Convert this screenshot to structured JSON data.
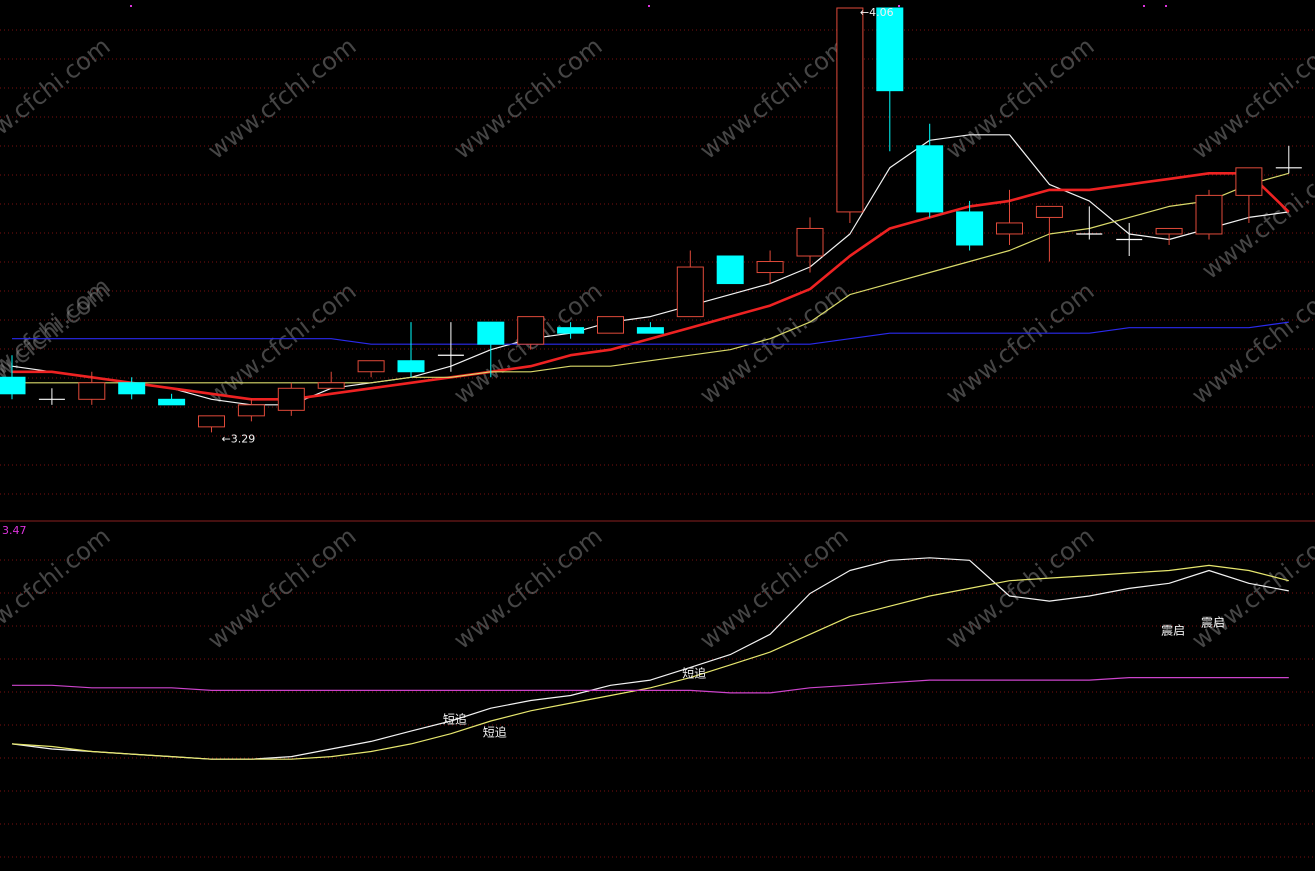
{
  "colors": {
    "background": "#000000",
    "grid": "#7a1010",
    "panel_divider": "#8a1f1f",
    "candle_up": "#e04a3a",
    "candle_down": "#00ffff",
    "ma_white": "#f2f2f2",
    "ma_red": "#ee2222",
    "ma_yellow": "#d9d96a",
    "ma_blue": "#2a2aee",
    "osc_white": "#f2f2f2",
    "osc_yellow": "#e6e66e",
    "osc_magenta": "#cc44cc",
    "watermark": "#9a9a9a",
    "scale_label": "#dd33dd",
    "annotation": "#f2f2f2"
  },
  "scale_label": "3.47",
  "watermark_text": "www.cfchi.com",
  "chart_data": [
    {
      "type": "candlestick",
      "panel": "price",
      "ylim": [
        3.18,
        4.06
      ],
      "candles": [
        {
          "o": 3.39,
          "h": 3.43,
          "l": 3.35,
          "c": 3.36
        },
        {
          "o": 3.35,
          "h": 3.37,
          "l": 3.34,
          "c": 3.35
        },
        {
          "o": 3.35,
          "h": 3.4,
          "l": 3.34,
          "c": 3.38
        },
        {
          "o": 3.38,
          "h": 3.39,
          "l": 3.35,
          "c": 3.36
        },
        {
          "o": 3.35,
          "h": 3.36,
          "l": 3.34,
          "c": 3.34
        },
        {
          "o": 3.3,
          "h": 3.32,
          "l": 3.29,
          "c": 3.32
        },
        {
          "o": 3.32,
          "h": 3.35,
          "l": 3.31,
          "c": 3.34
        },
        {
          "o": 3.33,
          "h": 3.38,
          "l": 3.32,
          "c": 3.37
        },
        {
          "o": 3.37,
          "h": 3.4,
          "l": 3.37,
          "c": 3.38
        },
        {
          "o": 3.4,
          "h": 3.42,
          "l": 3.39,
          "c": 3.42
        },
        {
          "o": 3.42,
          "h": 3.49,
          "l": 3.39,
          "c": 3.4
        },
        {
          "o": 3.43,
          "h": 3.49,
          "l": 3.4,
          "c": 3.43
        },
        {
          "o": 3.49,
          "h": 3.49,
          "l": 3.39,
          "c": 3.45
        },
        {
          "o": 3.45,
          "h": 3.5,
          "l": 3.44,
          "c": 3.5
        },
        {
          "o": 3.48,
          "h": 3.49,
          "l": 3.46,
          "c": 3.47
        },
        {
          "o": 3.47,
          "h": 3.5,
          "l": 3.47,
          "c": 3.5
        },
        {
          "o": 3.48,
          "h": 3.49,
          "l": 3.47,
          "c": 3.47
        },
        {
          "o": 3.5,
          "h": 3.62,
          "l": 3.5,
          "c": 3.59
        },
        {
          "o": 3.61,
          "h": 3.61,
          "l": 3.56,
          "c": 3.56
        },
        {
          "o": 3.58,
          "h": 3.62,
          "l": 3.56,
          "c": 3.6
        },
        {
          "o": 3.61,
          "h": 3.68,
          "l": 3.58,
          "c": 3.66
        },
        {
          "o": 3.69,
          "h": 4.06,
          "l": 3.67,
          "c": 4.06
        },
        {
          "o": 4.06,
          "h": 4.06,
          "l": 3.8,
          "c": 3.91
        },
        {
          "o": 3.81,
          "h": 3.85,
          "l": 3.68,
          "c": 3.69
        },
        {
          "o": 3.69,
          "h": 3.71,
          "l": 3.62,
          "c": 3.63
        },
        {
          "o": 3.65,
          "h": 3.73,
          "l": 3.63,
          "c": 3.67
        },
        {
          "o": 3.68,
          "h": 3.7,
          "l": 3.6,
          "c": 3.7
        },
        {
          "o": 3.65,
          "h": 3.7,
          "l": 3.64,
          "c": 3.65
        },
        {
          "o": 3.64,
          "h": 3.67,
          "l": 3.61,
          "c": 3.64
        },
        {
          "o": 3.65,
          "h": 3.66,
          "l": 3.63,
          "c": 3.66
        },
        {
          "o": 3.65,
          "h": 3.73,
          "l": 3.64,
          "c": 3.72
        },
        {
          "o": 3.72,
          "h": 3.77,
          "l": 3.67,
          "c": 3.77
        },
        {
          "o": 3.77,
          "h": 3.81,
          "l": 3.76,
          "c": 3.77
        }
      ],
      "lines": [
        {
          "color_key": "ma_white",
          "width": 1.2,
          "values": [
            3.41,
            3.4,
            3.39,
            3.38,
            3.37,
            3.35,
            3.34,
            3.34,
            3.37,
            3.38,
            3.39,
            3.41,
            3.44,
            3.46,
            3.47,
            3.49,
            3.5,
            3.52,
            3.54,
            3.56,
            3.59,
            3.65,
            3.77,
            3.82,
            3.83,
            3.83,
            3.74,
            3.71,
            3.65,
            3.64,
            3.66,
            3.68,
            3.69
          ]
        },
        {
          "color_key": "ma_red",
          "width": 2.6,
          "values": [
            3.4,
            3.4,
            3.39,
            3.38,
            3.37,
            3.36,
            3.35,
            3.35,
            3.36,
            3.37,
            3.38,
            3.39,
            3.4,
            3.41,
            3.43,
            3.44,
            3.46,
            3.48,
            3.5,
            3.52,
            3.55,
            3.61,
            3.66,
            3.68,
            3.7,
            3.71,
            3.73,
            3.73,
            3.74,
            3.75,
            3.76,
            3.76,
            3.69
          ]
        },
        {
          "color_key": "ma_yellow",
          "width": 1.2,
          "values": [
            3.38,
            3.38,
            3.38,
            3.38,
            3.38,
            3.38,
            3.38,
            3.38,
            3.38,
            3.38,
            3.39,
            3.39,
            3.4,
            3.4,
            3.41,
            3.41,
            3.42,
            3.43,
            3.44,
            3.46,
            3.49,
            3.54,
            3.56,
            3.58,
            3.6,
            3.62,
            3.65,
            3.66,
            3.68,
            3.7,
            3.71,
            3.74,
            3.76
          ]
        },
        {
          "color_key": "ma_blue",
          "width": 1.2,
          "values": [
            3.46,
            3.46,
            3.46,
            3.46,
            3.46,
            3.46,
            3.46,
            3.46,
            3.46,
            3.45,
            3.45,
            3.45,
            3.45,
            3.45,
            3.45,
            3.45,
            3.45,
            3.45,
            3.45,
            3.45,
            3.45,
            3.46,
            3.47,
            3.47,
            3.47,
            3.47,
            3.47,
            3.47,
            3.48,
            3.48,
            3.48,
            3.48,
            3.49
          ]
        }
      ],
      "annotations": [
        {
          "text": "4.06",
          "marker": "low-left",
          "index": 21,
          "value": 4.06
        },
        {
          "text": "3.29",
          "marker": "low-left",
          "index": 5,
          "value": 3.29
        }
      ]
    },
    {
      "type": "line",
      "panel": "oscillator",
      "ylim": [
        0,
        100
      ],
      "series": [
        {
          "color_key": "osc_white",
          "width": 1.2,
          "values": [
            22,
            20,
            19,
            18,
            17,
            16,
            16,
            17,
            20,
            23,
            27,
            31,
            36,
            39,
            41,
            45,
            47,
            52,
            57,
            65,
            81,
            90,
            94,
            95,
            94,
            80,
            78,
            80,
            83,
            85,
            90,
            85,
            82
          ]
        },
        {
          "color_key": "osc_yellow",
          "width": 1.2,
          "values": [
            22,
            21,
            19,
            18,
            17,
            16,
            16,
            16,
            17,
            19,
            22,
            26,
            31,
            35,
            38,
            41,
            44,
            48,
            53,
            58,
            65,
            72,
            76,
            80,
            83,
            86,
            87,
            88,
            89,
            90,
            92,
            90,
            86
          ]
        },
        {
          "color_key": "osc_magenta",
          "width": 1.2,
          "values": [
            45,
            45,
            44,
            44,
            44,
            43,
            43,
            43,
            43,
            43,
            43,
            43,
            43,
            43,
            43,
            43,
            43,
            43,
            42,
            42,
            44,
            45,
            46,
            47,
            47,
            47,
            47,
            47,
            48,
            48,
            48,
            48,
            48
          ]
        }
      ],
      "annotations": [
        {
          "text": "短追",
          "index": 11,
          "value": 30
        },
        {
          "text": "短追",
          "index": 12,
          "value": 25
        },
        {
          "text": "短追",
          "index": 17,
          "value": 48
        },
        {
          "text": "震启",
          "index": 29,
          "value": 65
        },
        {
          "text": "震启",
          "index": 30,
          "value": 68
        }
      ]
    }
  ]
}
